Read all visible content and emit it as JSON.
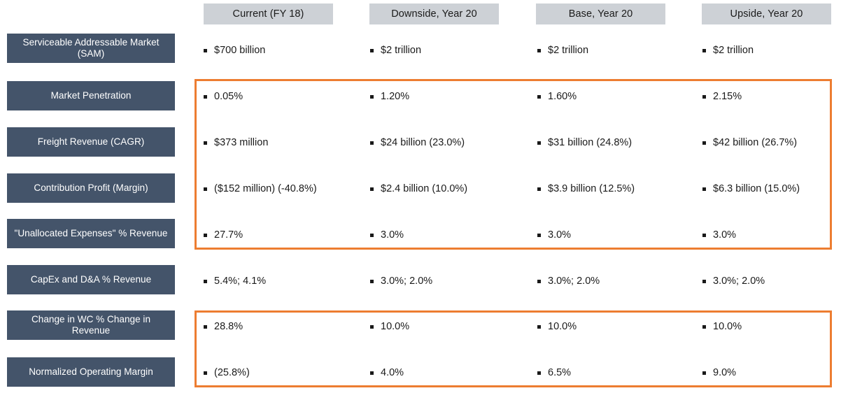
{
  "table": {
    "column_headers": [
      "Current (FY 18)",
      "Downside, Year 20",
      "Base, Year 20",
      "Upside, Year 20"
    ],
    "rows": [
      {
        "label": "Serviceable Addressable Market (SAM)",
        "values": [
          "$700 billion",
          "$2 trillion",
          "$2 trillion",
          "$2 trillion"
        ]
      },
      {
        "label": "Market Penetration",
        "values": [
          "0.05%",
          "1.20%",
          "1.60%",
          "2.15%"
        ]
      },
      {
        "label": "Freight Revenue (CAGR)",
        "values": [
          "$373 million",
          "$24 billion (23.0%)",
          "$31 billion (24.8%)",
          "$42 billion (26.7%)"
        ]
      },
      {
        "label": "Contribution Profit (Margin)",
        "values": [
          "($152 million) (-40.8%)",
          "$2.4 billion (10.0%)",
          "$3.9 billion (12.5%)",
          "$6.3 billion (15.0%)"
        ]
      },
      {
        "label": "\"Unallocated Expenses\" % Revenue",
        "values": [
          "27.7%",
          "3.0%",
          "3.0%",
          "3.0%"
        ]
      },
      {
        "label": "CapEx and D&A % Revenue",
        "values": [
          "5.4%; 4.1%",
          "3.0%; 2.0%",
          "3.0%; 2.0%",
          "3.0%; 2.0%"
        ]
      },
      {
        "label": "Change in WC % Change in Revenue",
        "values": [
          "28.8%",
          "10.0%",
          "10.0%",
          "10.0%"
        ]
      },
      {
        "label": "Normalized Operating Margin",
        "values": [
          "(25.8%)",
          "4.0%",
          "6.5%",
          "9.0%"
        ]
      }
    ],
    "highlight_boxes": [
      {
        "first_row": "Market Penetration",
        "last_row": "\"Unallocated Expenses\" % Revenue"
      },
      {
        "first_row": "Change in WC % Change in Revenue",
        "last_row": "Normalized Operating Margin"
      }
    ]
  },
  "colors": {
    "row_label_background": "#44546A",
    "column_header_background": "#CDD1D6",
    "highlight_border": "#ED7D31",
    "text": "#1A1A1A",
    "page_background": "#FFFFFF"
  }
}
